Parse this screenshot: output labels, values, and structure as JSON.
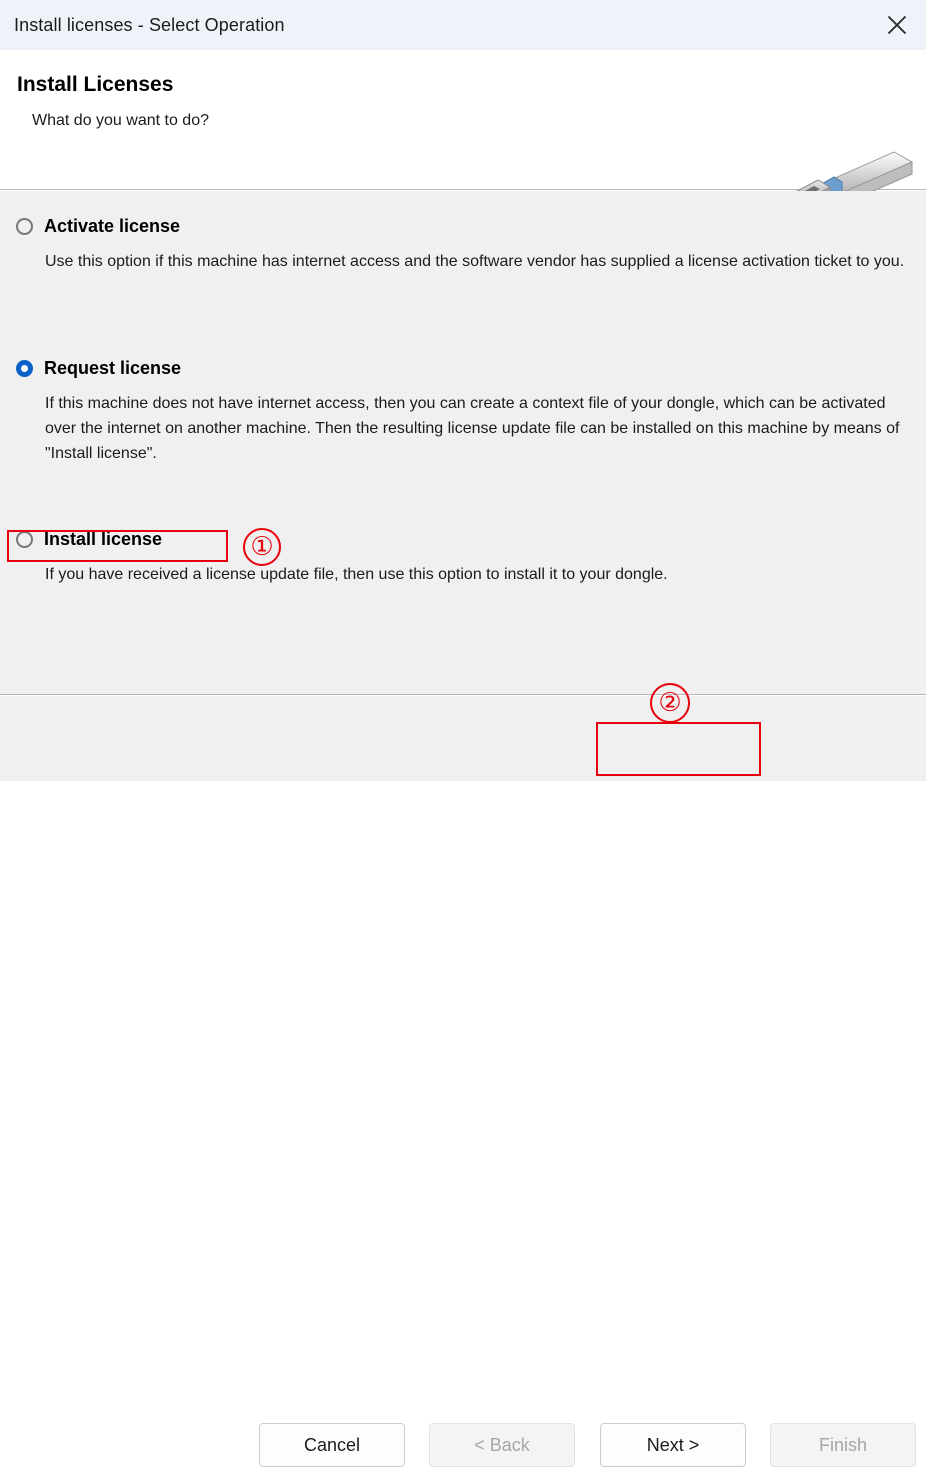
{
  "window": {
    "title": "Install licenses - Select Operation",
    "close_icon": "close-icon"
  },
  "header": {
    "title": "Install Licenses",
    "subtitle": "What do you want to do?",
    "image_icon": "usb-dongle-icon"
  },
  "options": [
    {
      "id": "activate",
      "label": "Activate license",
      "selected": false,
      "description": "Use this option if this machine has internet access and the software vendor has supplied a license activation ticket to you."
    },
    {
      "id": "request",
      "label": "Request license",
      "selected": true,
      "description": "If this machine does not have internet access, then you can create a context file of your dongle, which can be activated over the internet on another machine. Then the resulting license update file can be installed on this machine by means of \"Install license\"."
    },
    {
      "id": "install",
      "label": "Install license",
      "selected": false,
      "description": "If you have received a license update file, then use this option to install it to your dongle."
    }
  ],
  "buttons": [
    {
      "id": "cancel",
      "label": "Cancel",
      "enabled": true
    },
    {
      "id": "back",
      "label": "< Back",
      "enabled": false
    },
    {
      "id": "next",
      "label": "Next >",
      "enabled": true
    },
    {
      "id": "finish",
      "label": "Finish",
      "enabled": false
    }
  ],
  "annotations": {
    "color": "#e8000d",
    "markers": [
      {
        "id": "one",
        "label": "①",
        "target": "install-license-option"
      },
      {
        "id": "two",
        "label": "②",
        "target": "next-button"
      }
    ]
  }
}
